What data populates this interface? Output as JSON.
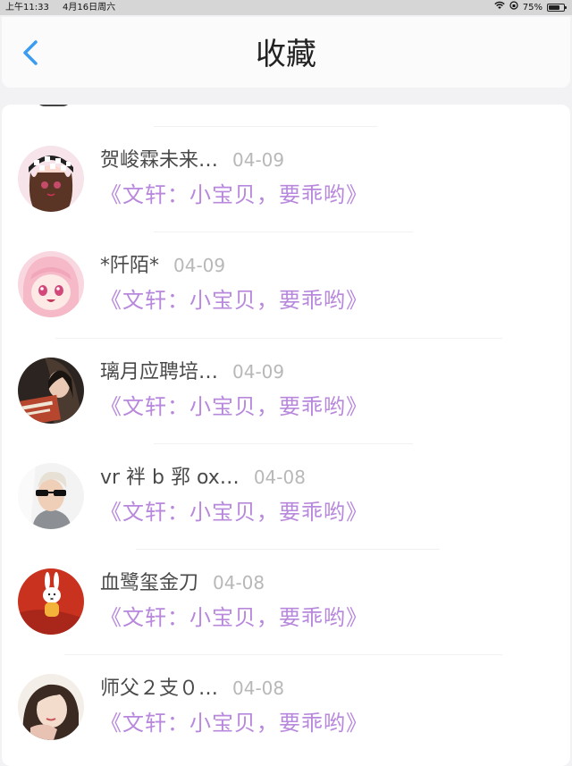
{
  "status_bar": {
    "time": "上午11:33",
    "date": "4月16日周六",
    "battery": "75%",
    "battery_level": 0.75,
    "icons": [
      "wifi-icon",
      "orientation-lock-icon",
      "battery-icon"
    ]
  },
  "header": {
    "title": "收藏",
    "back_icon": "chevron-left-icon",
    "accent_color": "#3b9cf0"
  },
  "favorites": [
    {
      "name": "贺峻霖未来…",
      "date": "04-09",
      "quote": "《文轩：小宝贝，要乖哟》",
      "avatar": "avatar-checker-hat-girl"
    },
    {
      "name": "*阡陌*",
      "date": "04-09",
      "quote": "《文轩：小宝贝，要乖哟》",
      "avatar": "avatar-pink-anime-girl"
    },
    {
      "name": "璃月应聘培…",
      "date": "04-09",
      "quote": "《文轩：小宝贝，要乖哟》",
      "avatar": "avatar-girl-reading"
    },
    {
      "name": "vr 袢 b 郛 ox…",
      "date": "04-08",
      "quote": "《文轩：小宝贝，要乖哟》",
      "avatar": "avatar-man-sunglasses"
    },
    {
      "name": "血鹭玺金刀",
      "date": "04-08",
      "quote": "《文轩：小宝贝，要乖哟》",
      "avatar": "avatar-bunny-toy"
    },
    {
      "name": "师父２支０…",
      "date": "04-08",
      "quote": "《文轩：小宝贝，要乖哟》",
      "avatar": "avatar-girl-portrait"
    }
  ],
  "colors": {
    "quote": "#b888dc",
    "name": "#4a4a4a",
    "date": "#b8b8b8",
    "background": "#f2f2f4"
  }
}
